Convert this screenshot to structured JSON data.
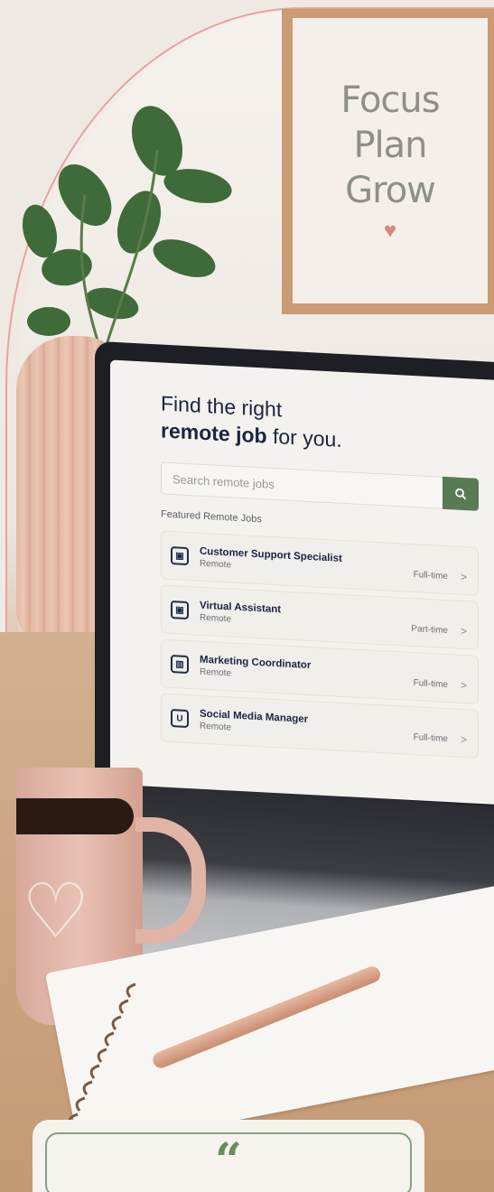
{
  "poster": {
    "lines": [
      "Focus",
      "Plan",
      "Grow"
    ],
    "heart": "♥"
  },
  "screen": {
    "headline_line1": "Find the right",
    "headline_bold": "remote job",
    "headline_rest": " for you.",
    "search_placeholder": "Search remote jobs",
    "featured_label": "Featured Remote Jobs",
    "jobs": [
      {
        "title": "Customer Support Specialist",
        "location": "Remote",
        "type": "Full-time",
        "icon": "building-icon"
      },
      {
        "title": "Virtual Assistant",
        "location": "Remote",
        "type": "Part-time",
        "icon": "building-icon"
      },
      {
        "title": "Marketing Coordinator",
        "location": "Remote",
        "type": "Full-time",
        "icon": "bank-icon"
      },
      {
        "title": "Social Media Manager",
        "location": "Remote",
        "type": "Full-time",
        "icon": "u-logo-icon"
      }
    ],
    "chevron": ">"
  },
  "quote": {
    "mark": "“"
  },
  "colors": {
    "accent_green": "#587b55",
    "navy": "#1b2440",
    "arch_border": "#e7a3a0"
  }
}
